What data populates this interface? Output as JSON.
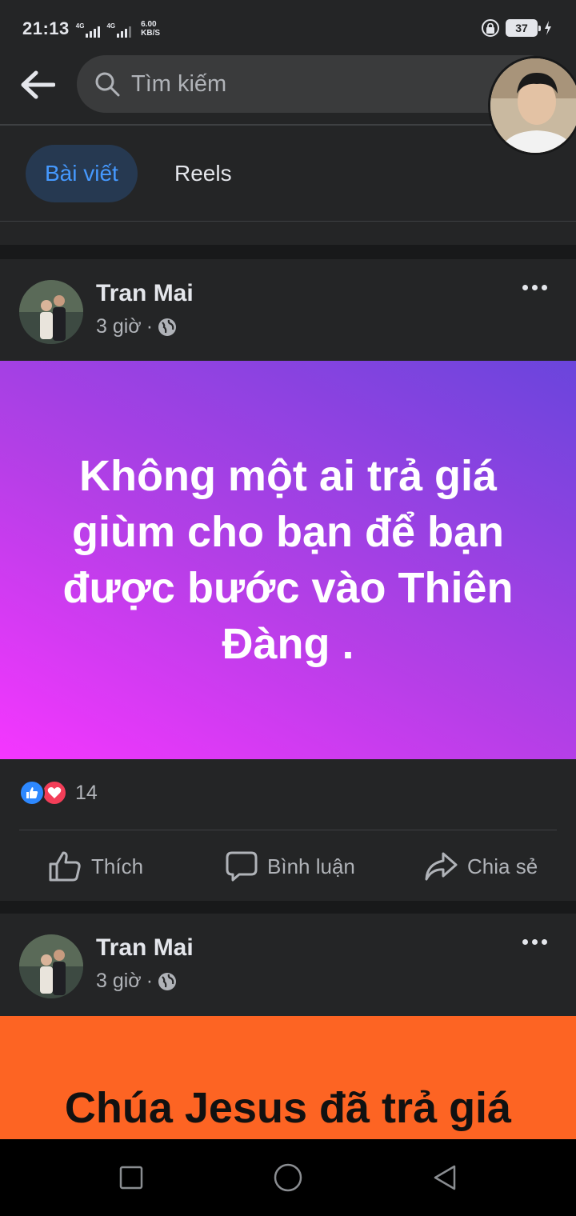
{
  "status_bar": {
    "time": "21:13",
    "network_1": "4G",
    "network_2": "4G",
    "speed_value": "6.00",
    "speed_unit": "KB/S",
    "battery": "37"
  },
  "search": {
    "placeholder": "Tìm kiếm"
  },
  "tabs": [
    {
      "label": "Bài viết",
      "active": true
    },
    {
      "label": "Reels",
      "active": false
    }
  ],
  "posts": [
    {
      "author": "Tran Mai",
      "time": "3 giờ",
      "separator": "·",
      "text": "Không một ai trả giá giùm cho bạn để bạn được bước vào Thiên Đàng .",
      "background_color": "#b33fe6",
      "reactions_count": "14",
      "actions": {
        "like": "Thích",
        "comment": "Bình luận",
        "share": "Chia sẻ"
      }
    },
    {
      "author": "Tran Mai",
      "time": "3 giờ",
      "separator": "·",
      "text": "Chúa Jesus đã trả giá",
      "background_color": "#fd6423"
    }
  ],
  "icons": {
    "back": "arrow-left-icon",
    "search": "search-icon",
    "audience": "globe-icon",
    "more": "more-icon",
    "like_reaction": "like-reaction-icon",
    "love_reaction": "love-reaction-icon",
    "like": "thumbs-up-icon",
    "comment": "comment-icon",
    "share": "share-icon",
    "nav_recent": "square-icon",
    "nav_home": "circle-icon",
    "nav_back": "triangle-back-icon"
  },
  "colors": {
    "accent": "#4599ff",
    "active_tab_bg": "#263951",
    "surface": "#242526",
    "background": "#18191a"
  }
}
